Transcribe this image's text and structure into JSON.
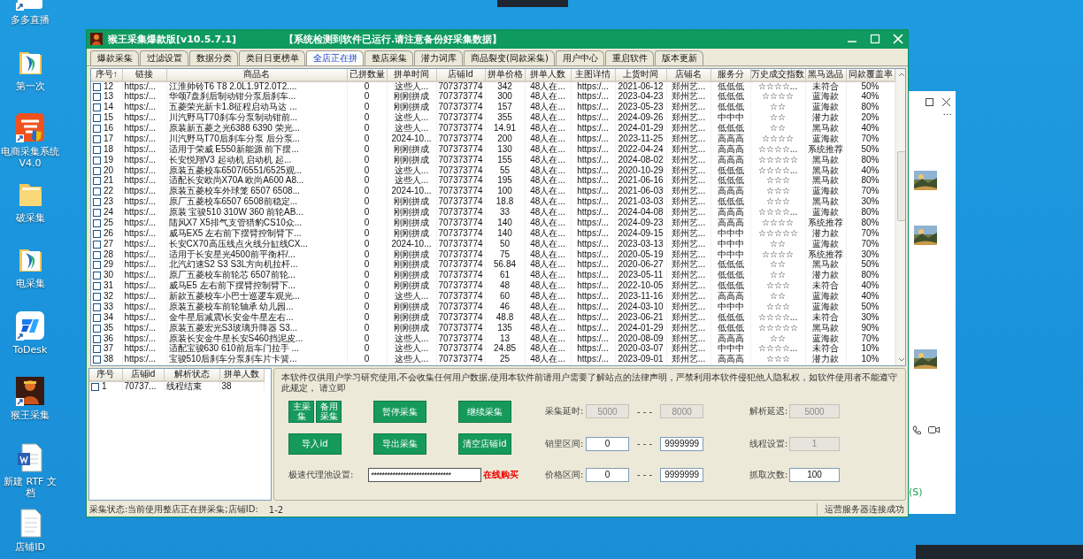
{
  "desktop": {
    "icons": [
      {
        "label": "多多直播",
        "kind": "store"
      },
      {
        "label": "第一次",
        "kind": "folderlogo"
      },
      {
        "label": "电商采集系统 V4.0",
        "kind": "taobao"
      },
      {
        "label": "破采集",
        "kind": "folder"
      },
      {
        "label": "电采集",
        "kind": "folderlogo"
      },
      {
        "label": "ToDesk",
        "kind": "todesk"
      },
      {
        "label": "猴王采集",
        "kind": "monkey"
      },
      {
        "label": "新建 RTF 文档",
        "kind": "word"
      },
      {
        "label": "店铺ID",
        "kind": "file"
      }
    ]
  },
  "window": {
    "title": "猴王采集爆款版[v10.5.7.1]",
    "notice": "【系统检测到软件已运行.请注意备份好采集数据】"
  },
  "tabs": [
    {
      "label": "爆款采集",
      "selected": false
    },
    {
      "label": "过滤设置",
      "selected": false
    },
    {
      "label": "数据分类",
      "selected": false
    },
    {
      "label": "类目日更榜单",
      "selected": false
    },
    {
      "label": "全店正在拼",
      "selected": true
    },
    {
      "label": "整店采集",
      "selected": false
    },
    {
      "label": "潜力词库",
      "selected": false
    },
    {
      "label": "商品裂变(同款采集)",
      "selected": false
    },
    {
      "label": "用户中心",
      "selected": false
    },
    {
      "label": "重启软件",
      "selected": false
    },
    {
      "label": "版本更新",
      "selected": false
    }
  ],
  "table": {
    "columns": [
      "序号↑",
      "链接",
      "商品名",
      "已拼数量",
      "拼单时间",
      "店铺Id",
      "拼单价格",
      "拼单人数",
      "主图详情",
      "上货时间",
      "店铺名",
      "服务分",
      "万史成交指数",
      "黑马选品",
      "同款覆盖率"
    ],
    "rows": [
      {
        "checked": false,
        "cells": [
          "12",
          "https:/...",
          "江淮帅铃T6 T8 2.0L1.9T2.0T2....",
          "0",
          "这些人...",
          "707373774",
          "342",
          "48人在...",
          "https:/...",
          "2021-06-12",
          "郑州艺...",
          "低低低",
          "☆☆☆☆...",
          "未符合",
          "50%"
        ]
      },
      {
        "checked": false,
        "cells": [
          "13",
          "https:/...",
          "华颂7盘刹后制动钳分泵后刹车...",
          "0",
          "刚刚拼成",
          "707373774",
          "300",
          "48人在...",
          "https:/...",
          "2023-04-23",
          "郑州艺...",
          "低低低",
          "☆☆☆☆",
          "蓝海款",
          "40%"
        ]
      },
      {
        "checked": false,
        "cells": [
          "14",
          "https:/...",
          "五菱荣光新卡1.8征程启动马达 ...",
          "0",
          "刚刚拼成",
          "707373774",
          "157",
          "48人在...",
          "https:/...",
          "2023-05-23",
          "郑州艺...",
          "低低低",
          "☆☆",
          "蓝海款",
          "80%"
        ]
      },
      {
        "checked": false,
        "cells": [
          "15",
          "https:/...",
          "川汽野马T70刹车分泵制动钳前...",
          "0",
          "这些人...",
          "707373774",
          "355",
          "48人在...",
          "https:/...",
          "2024-09-26",
          "郑州艺...",
          "中中中",
          "☆☆",
          "潜力款",
          "20%"
        ]
      },
      {
        "checked": false,
        "cells": [
          "16",
          "https:/...",
          "原装新五菱之光6388 6390 荣光...",
          "0",
          "这些人...",
          "707373774",
          "14.91",
          "48人在...",
          "https:/...",
          "2024-01-29",
          "郑州艺...",
          "低低低",
          "☆☆",
          "黑马款",
          "40%"
        ]
      },
      {
        "checked": false,
        "cells": [
          "17",
          "https:/...",
          "川汽野马T70后刹车分泵 后分泵...",
          "0",
          "2024-10...",
          "707373774",
          "200",
          "48人在...",
          "https:/...",
          "2023-11-25",
          "郑州艺...",
          "高高高",
          "☆☆☆☆",
          "蓝海款",
          "70%"
        ]
      },
      {
        "checked": false,
        "cells": [
          "18",
          "https:/...",
          "适用于荣威 E550新能源 前下摆...",
          "0",
          "刚刚拼成",
          "707373774",
          "130",
          "48人在...",
          "https:/...",
          "2022-04-24",
          "郑州艺...",
          "高高高",
          "☆☆☆☆...",
          "系统推荐",
          "50%"
        ]
      },
      {
        "checked": false,
        "cells": [
          "19",
          "https:/...",
          "长安悦翔V3 起动机 启动机 起...",
          "0",
          "刚刚拼成",
          "707373774",
          "155",
          "48人在...",
          "https:/...",
          "2024-08-02",
          "郑州艺...",
          "高高高",
          "☆☆☆☆☆",
          "黑马款",
          "80%"
        ]
      },
      {
        "checked": false,
        "cells": [
          "20",
          "https:/...",
          "原装五菱校车6507/6551/6525观...",
          "0",
          "这些人...",
          "707373774",
          "55",
          "48人在...",
          "https:/...",
          "2020-10-29",
          "郑州艺...",
          "低低低",
          "☆☆☆☆...",
          "黑马款",
          "40%"
        ]
      },
      {
        "checked": false,
        "cells": [
          "21",
          "https:/...",
          "适配长安欧尚X70A 欧尚A600 A8...",
          "0",
          "这些人...",
          "707373774",
          "195",
          "48人在...",
          "https:/...",
          "2021-06-16",
          "郑州艺...",
          "低低低",
          "☆☆☆",
          "黑马款",
          "80%"
        ]
      },
      {
        "checked": false,
        "cells": [
          "22",
          "https:/...",
          "原装五菱校车外球笼 6507 6508...",
          "0",
          "2024-10...",
          "707373774",
          "100",
          "48人在...",
          "https:/...",
          "2021-06-03",
          "郑州艺...",
          "高高高",
          "☆☆☆",
          "蓝海款",
          "70%"
        ]
      },
      {
        "checked": false,
        "cells": [
          "23",
          "https:/...",
          "原厂五菱校车6507 6508前稳定...",
          "0",
          "刚刚拼成",
          "707373774",
          "18.8",
          "48人在...",
          "https:/...",
          "2021-03-03",
          "郑州艺...",
          "低低低",
          "☆☆☆",
          "黑马款",
          "30%"
        ]
      },
      {
        "checked": false,
        "cells": [
          "24",
          "https:/...",
          "原装 宝骏510 310W 360 前轮AB...",
          "0",
          "刚刚拼成",
          "707373774",
          "33",
          "48人在...",
          "https:/...",
          "2024-04-08",
          "郑州艺...",
          "高高高",
          "☆☆☆☆...",
          "蓝海款",
          "80%"
        ]
      },
      {
        "checked": false,
        "cells": [
          "25",
          "https:/...",
          "陆风X7 X5排气支管猎豹CS10众...",
          "0",
          "刚刚拼成",
          "707373774",
          "140",
          "48人在...",
          "https:/...",
          "2024-09-23",
          "郑州艺...",
          "高高高",
          "☆☆☆☆",
          "系统推荐",
          "80%"
        ]
      },
      {
        "checked": false,
        "cells": [
          "26",
          "https:/...",
          "威马EX5 左右前下摆臂控制臂下...",
          "0",
          "刚刚拼成",
          "707373774",
          "140",
          "48人在...",
          "https:/...",
          "2024-09-15",
          "郑州艺...",
          "中中中",
          "☆☆☆☆☆",
          "潜力款",
          "70%"
        ]
      },
      {
        "checked": false,
        "cells": [
          "27",
          "https:/...",
          "长安CX70高压线点火线分缸线CX...",
          "0",
          "2024-10...",
          "707373774",
          "50",
          "48人在...",
          "https:/...",
          "2023-03-13",
          "郑州艺...",
          "中中中",
          "☆☆",
          "蓝海款",
          "70%"
        ]
      },
      {
        "checked": false,
        "cells": [
          "28",
          "https:/...",
          "适用于长安星光4500前平衡杆/...",
          "0",
          "刚刚拼成",
          "707373774",
          "75",
          "48人在...",
          "https:/...",
          "2020-05-19",
          "郑州艺...",
          "中中中",
          "☆☆☆☆",
          "系统推荐",
          "30%"
        ]
      },
      {
        "checked": false,
        "cells": [
          "29",
          "https:/...",
          "北汽幻速S2 S3 S3L方向机拉杆...",
          "0",
          "刚刚拼成",
          "707373774",
          "56.84",
          "48人在...",
          "https:/...",
          "2020-06-27",
          "郑州艺...",
          "低低低",
          "☆☆",
          "黑马款",
          "50%"
        ]
      },
      {
        "checked": false,
        "cells": [
          "30",
          "https:/...",
          "原厂五菱校车前轮芯 6507前轮...",
          "0",
          "刚刚拼成",
          "707373774",
          "61",
          "48人在...",
          "https:/...",
          "2023-05-11",
          "郑州艺...",
          "低低低",
          "☆☆",
          "潜力款",
          "80%"
        ]
      },
      {
        "checked": false,
        "cells": [
          "31",
          "https:/...",
          "威马E5 左右前下摆臂控制臂下...",
          "0",
          "刚刚拼成",
          "707373774",
          "48",
          "48人在...",
          "https:/...",
          "2022-10-05",
          "郑州艺...",
          "低低低",
          "☆☆☆",
          "未符合",
          "40%"
        ]
      },
      {
        "checked": false,
        "cells": [
          "32",
          "https:/...",
          "新款五菱校车小巴士巡逻车观光...",
          "0",
          "这些人...",
          "707373774",
          "60",
          "48人在...",
          "https:/...",
          "2023-11-16",
          "郑州艺...",
          "高高高",
          "☆☆",
          "蓝海款",
          "40%"
        ]
      },
      {
        "checked": false,
        "cells": [
          "33",
          "https:/...",
          "原装五菱校车前轮轴承 幼儿园...",
          "0",
          "刚刚拼成",
          "707373774",
          "46",
          "48人在...",
          "https:/...",
          "2024-03-10",
          "郑州艺...",
          "中中中",
          "☆☆☆",
          "蓝海款",
          "50%"
        ]
      },
      {
        "checked": false,
        "cells": [
          "34",
          "https:/...",
          "金牛星后减震\\长安金牛星左右...",
          "0",
          "刚刚拼成",
          "707373774",
          "48.8",
          "48人在...",
          "https:/...",
          "2023-06-21",
          "郑州艺...",
          "低低低",
          "☆☆☆☆...",
          "未符合",
          "30%"
        ]
      },
      {
        "checked": false,
        "cells": [
          "35",
          "https:/...",
          "原装五菱宏光S3玻璃升降器 S3...",
          "0",
          "刚刚拼成",
          "707373774",
          "135",
          "48人在...",
          "https:/...",
          "2024-01-29",
          "郑州艺...",
          "低低低",
          "☆☆☆☆☆",
          "黑马款",
          "90%"
        ]
      },
      {
        "checked": false,
        "cells": [
          "36",
          "https:/...",
          "原装长安金牛星长安S460挡泥皮...",
          "0",
          "这些人...",
          "707373774",
          "13",
          "48人在...",
          "https:/...",
          "2020-08-09",
          "郑州艺...",
          "高高高",
          "☆☆",
          "蓝海款",
          "70%"
        ]
      },
      {
        "checked": false,
        "cells": [
          "37",
          "https:/...",
          "适配宝骏630 610前后车门拉手 ...",
          "0",
          "这些人...",
          "707373774",
          "24.85",
          "48人在...",
          "https:/...",
          "2020-03-07",
          "郑州艺...",
          "中中中",
          "☆☆☆☆...",
          "未符合",
          "10%"
        ]
      },
      {
        "checked": false,
        "cells": [
          "38",
          "https:/...",
          "宝骏510后刹车分泵刹车片卡簧...",
          "0",
          "这些人...",
          "707373774",
          "25",
          "48人在...",
          "https:/...",
          "2023-09-01",
          "郑州艺...",
          "高高高",
          "☆☆☆",
          "潜力款",
          "10%"
        ]
      }
    ]
  },
  "jobs": {
    "columns": [
      "序号",
      "店铺id",
      "解析状态",
      "拼单人数"
    ],
    "rows": [
      {
        "checked": false,
        "cells": [
          "1",
          "70737...",
          "线程结束",
          "38"
        ]
      }
    ]
  },
  "panel": {
    "notice": "本软件仅供用户学习研究使用,不会收集任何用户数据,使用本软件前请用户需要了解站点的法律声明，严禁利用本软件侵犯他人隐私权，如软件使用者不能遵守此规定， 请立即",
    "button_rows": [
      [
        {
          "label": "主采集",
          "kind": "half"
        },
        {
          "label": "备用采集",
          "kind": "half"
        },
        {
          "label": "暂停采集",
          "kind": "full"
        },
        {
          "label": "继续采集",
          "kind": "full"
        }
      ],
      [
        {
          "label": "导入id",
          "kind": "full"
        },
        {
          "label": "导出采集",
          "kind": "full"
        },
        {
          "label": "清空店铺id",
          "kind": "full"
        }
      ]
    ],
    "proxy": {
      "label": "极速代理池设置:",
      "value": "******************************",
      "link": "在线购买"
    },
    "ranges": [
      {
        "label": "采集延时:",
        "from": "5000",
        "separator": "- - -",
        "to": "8000",
        "disabled": true
      },
      {
        "label": "销里区间:",
        "from": "0",
        "separator": "- - -",
        "to": "9999999",
        "disabled": false
      },
      {
        "label": "价格区间:",
        "from": "0",
        "separator": "- - -",
        "to": "9999999",
        "disabled": false
      }
    ],
    "fields": [
      {
        "label": "解析延迟:",
        "value": "5000",
        "disabled": true
      },
      {
        "label": "线程设置:",
        "value": "1",
        "disabled": true
      },
      {
        "label": "抓取次数:",
        "value": "100",
        "disabled": false
      }
    ]
  },
  "status_bar": {
    "text": "采集状态:当前使用整店正在拼采集;店铺ID:",
    "value": "1-2",
    "server": "运营服务器连接成功"
  },
  "side_window": {
    "more": "...",
    "status": "(S)"
  }
}
